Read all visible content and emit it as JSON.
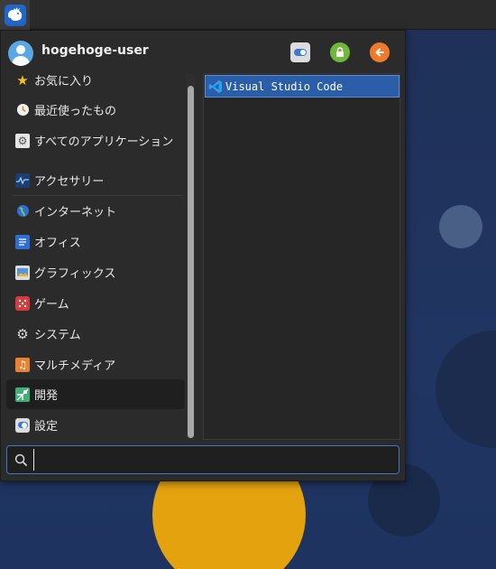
{
  "user": {
    "name": "hogehoge-user"
  },
  "header_buttons": [
    {
      "name": "settings",
      "icon": "toggle-settings-icon"
    },
    {
      "name": "lock",
      "icon": "lock-icon"
    },
    {
      "name": "logout",
      "icon": "logout-arrow-icon"
    }
  ],
  "categories_top": [
    {
      "label": "お気に入り",
      "icon": "star-icon"
    },
    {
      "label": "最近使ったもの",
      "icon": "recent-clock-icon"
    },
    {
      "label": "すべてのアプリケーション",
      "icon": "all-apps-gear-icon"
    }
  ],
  "categories": [
    {
      "label": "アクセサリー",
      "icon": "accessories-monitor-icon"
    },
    {
      "label": "インターネット",
      "icon": "globe-icon"
    },
    {
      "label": "オフィス",
      "icon": "office-document-icon"
    },
    {
      "label": "グラフィックス",
      "icon": "graphics-image-icon"
    },
    {
      "label": "ゲーム",
      "icon": "dice-icon"
    },
    {
      "label": "システム",
      "icon": "system-gear-icon"
    },
    {
      "label": "マルチメディア",
      "icon": "music-note-icon"
    },
    {
      "label": "開発",
      "icon": "development-icon",
      "selected": true
    },
    {
      "label": "設定",
      "icon": "settings-toggle-icon"
    }
  ],
  "apps": [
    {
      "label": "Visual Studio Code",
      "icon": "vscode-icon",
      "selected": true
    }
  ],
  "search": {
    "value": "",
    "placeholder": ""
  },
  "colors": {
    "accent": "#2b5ea9",
    "panel": "#2b2b2b",
    "wallpaper": "#1f3158",
    "sun": "#e3a20e"
  }
}
